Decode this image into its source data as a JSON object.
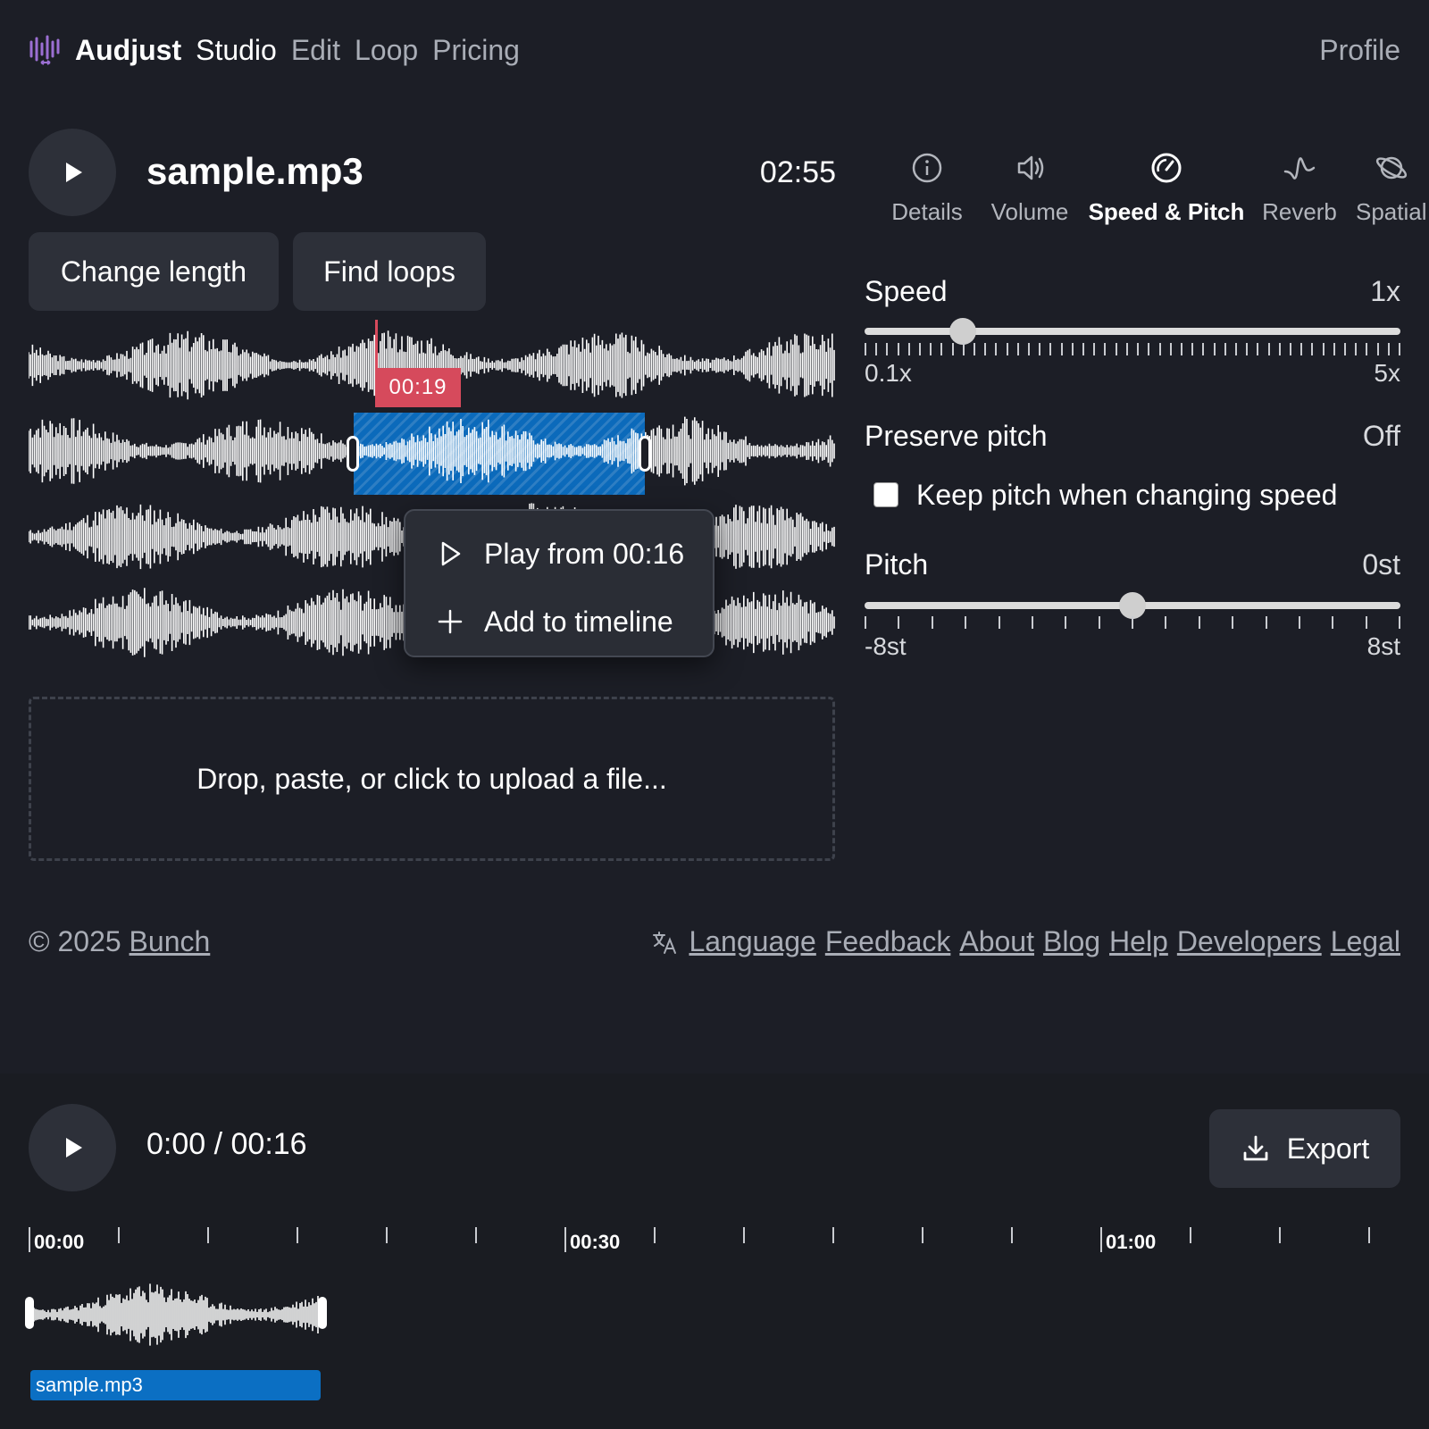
{
  "nav": {
    "brand": "Audjust",
    "links": [
      "Studio",
      "Edit",
      "Loop",
      "Pricing"
    ],
    "profile": "Profile",
    "accent": "#9b6fd3"
  },
  "player": {
    "file_name": "sample.mp3",
    "duration": "02:55",
    "play_icon": "play-icon",
    "change_length_label": "Change length",
    "find_loops_label": "Find loops",
    "playhead_time": "00:19",
    "selection_color": "#0b6fc3",
    "playhead_color": "#d64a5c"
  },
  "context_menu": {
    "items": [
      {
        "label": "Play from 00:16",
        "icon": "play-outline-icon"
      },
      {
        "label": "Add to timeline",
        "icon": "plus-icon"
      }
    ]
  },
  "upload": {
    "label": "Drop, paste, or click to upload a file..."
  },
  "tabs": [
    {
      "label": "Details",
      "icon": "info-icon"
    },
    {
      "label": "Volume",
      "icon": "speaker-icon"
    },
    {
      "label": "Speed & Pitch",
      "icon": "gauge-icon",
      "active": true
    },
    {
      "label": "Reverb",
      "icon": "waveform-icon"
    },
    {
      "label": "Spatial",
      "icon": "planet-icon"
    }
  ],
  "speed": {
    "label": "Speed",
    "value": "1x",
    "min_label": "0.1x",
    "max_label": "5x",
    "min": 0.1,
    "max": 5,
    "current": 1
  },
  "preserve_pitch": {
    "label": "Preserve pitch",
    "value": "Off",
    "checkbox_label": "Keep pitch when changing speed",
    "checked": false
  },
  "pitch": {
    "label": "Pitch",
    "value": "0st",
    "min_label": "-8st",
    "max_label": "8st",
    "min": -8,
    "max": 8,
    "current": 0
  },
  "footer": {
    "copyright_prefix": "© 2025",
    "company": "Bunch",
    "links": [
      "Language",
      "Feedback",
      "About",
      "Blog",
      "Help",
      "Developers",
      "Legal"
    ]
  },
  "timeline": {
    "time_readout": "0:00 / 00:16",
    "export_label": "Export",
    "ruler_labels": [
      "00:00",
      "00:30",
      "01:00"
    ],
    "clip_name": "sample.mp3"
  }
}
